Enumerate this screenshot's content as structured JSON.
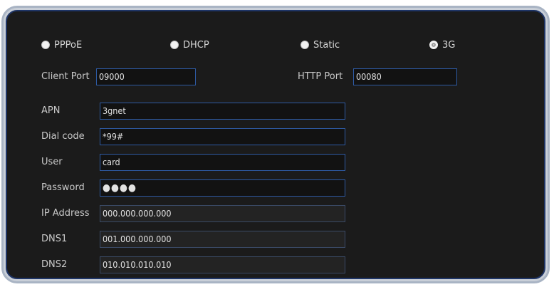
{
  "connection_types": [
    {
      "label": "PPPoE",
      "selected": false
    },
    {
      "label": "DHCP",
      "selected": false
    },
    {
      "label": "Static",
      "selected": false
    },
    {
      "label": "3G",
      "selected": true
    }
  ],
  "ports": {
    "client_port_label": "Client Port",
    "client_port_value": "09000",
    "http_port_label": "HTTP Port",
    "http_port_value": "00080"
  },
  "fields": {
    "apn": {
      "label": "APN",
      "value": "3gnet"
    },
    "dial_code": {
      "label": "Dial code",
      "value": "*99#"
    },
    "user": {
      "label": "User",
      "value": "card"
    },
    "password": {
      "label": "Password",
      "value": "●●●●"
    },
    "ip_address": {
      "label": "IP Address",
      "value": "000.000.000.000"
    },
    "dns1": {
      "label": "DNS1",
      "value": "001.000.000.000"
    },
    "dns2": {
      "label": "DNS2",
      "value": "010.010.010.010"
    }
  }
}
